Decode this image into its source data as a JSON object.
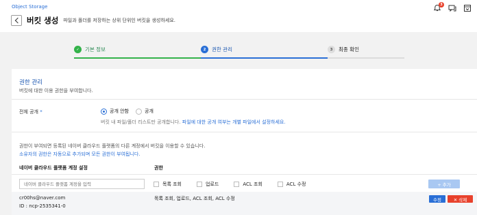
{
  "header": {
    "breadcrumb": "Object Storage",
    "title": "버킷 생성",
    "description": "파일과 폴더를 저장하는 상위 단위인 버킷을 생성하세요.",
    "icons": [
      "bell-icon",
      "chat-icon",
      "window-icon"
    ],
    "notification_count": "3"
  },
  "stepper": {
    "steps": [
      {
        "number": "✓",
        "label": "기본 정보",
        "state": "done"
      },
      {
        "number": "2",
        "label": "권한 관리",
        "state": "active"
      },
      {
        "number": "3",
        "label": "최종 확인",
        "state": "pending"
      }
    ],
    "colors": {
      "done": "#33b24a",
      "active": "#2a6fd6",
      "pending": "#dddddd"
    }
  },
  "section": {
    "title": "권한 관리",
    "description": "버킷에 대한 이용 권한을 부여합니다."
  },
  "public_setting": {
    "label": "전체 공개",
    "required_mark": "*",
    "options": [
      "공개 안함",
      "공개"
    ],
    "selected": "공개 안함",
    "hint_text": "버킷 내 파일/폴더 리스트만 공개합니다.",
    "hint_link": "파일에 대한 공개 여부는 개별 파일에서 설정하세요."
  },
  "permissions": {
    "note": "권한이 부여되면 등록된 네이버 클라우드 플랫폼의 다른 계정에서 버킷을 이용할 수 있습니다.",
    "owner_note": "소유자의 권한은 자동으로 추가되며 모든 권한이 부여됩니다.",
    "col_account": "네이버 클라우드 플랫폼 계정 설정",
    "col_permission": "권한",
    "account_placeholder": "네이버 클라우드 플랫폼 계정을 입력",
    "checkboxes": [
      "목록 조회",
      "업로드",
      "ACL 조회",
      "ACL 수정"
    ],
    "add_button": "+ 추가",
    "rows": [
      {
        "email": "cr00hs@naver.com",
        "id": "ID : ncp-2535341-0",
        "perms": "목록 조회, 업로드, ACL 조회, ACL 수정",
        "edit_label": "수정",
        "delete_label": "✕ 삭제"
      }
    ]
  }
}
